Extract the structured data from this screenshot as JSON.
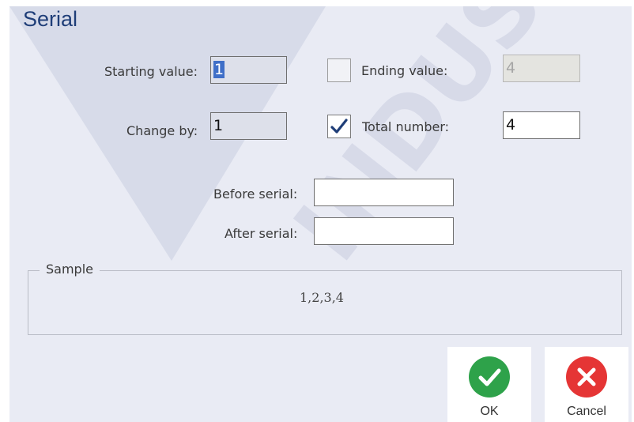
{
  "dialog": {
    "title": "Serial"
  },
  "watermark": {
    "text": "INDUSTRI"
  },
  "fields": {
    "starting_value": {
      "label": "Starting value:",
      "value": "1"
    },
    "ending_value": {
      "label": "Ending value:",
      "value": "4",
      "enabled": false
    },
    "change_by": {
      "label": "Change by:",
      "value": "1"
    },
    "total_number": {
      "label": "Total number:",
      "value": "4",
      "checked": true
    },
    "before_serial": {
      "label": "Before serial:",
      "value": ""
    },
    "after_serial": {
      "label": "After serial:",
      "value": ""
    }
  },
  "sample": {
    "legend": "Sample",
    "value": "1,2,3,4"
  },
  "buttons": {
    "ok": {
      "label": "OK",
      "color": "#2ea24a"
    },
    "cancel": {
      "label": "Cancel",
      "color": "#e53535"
    }
  }
}
